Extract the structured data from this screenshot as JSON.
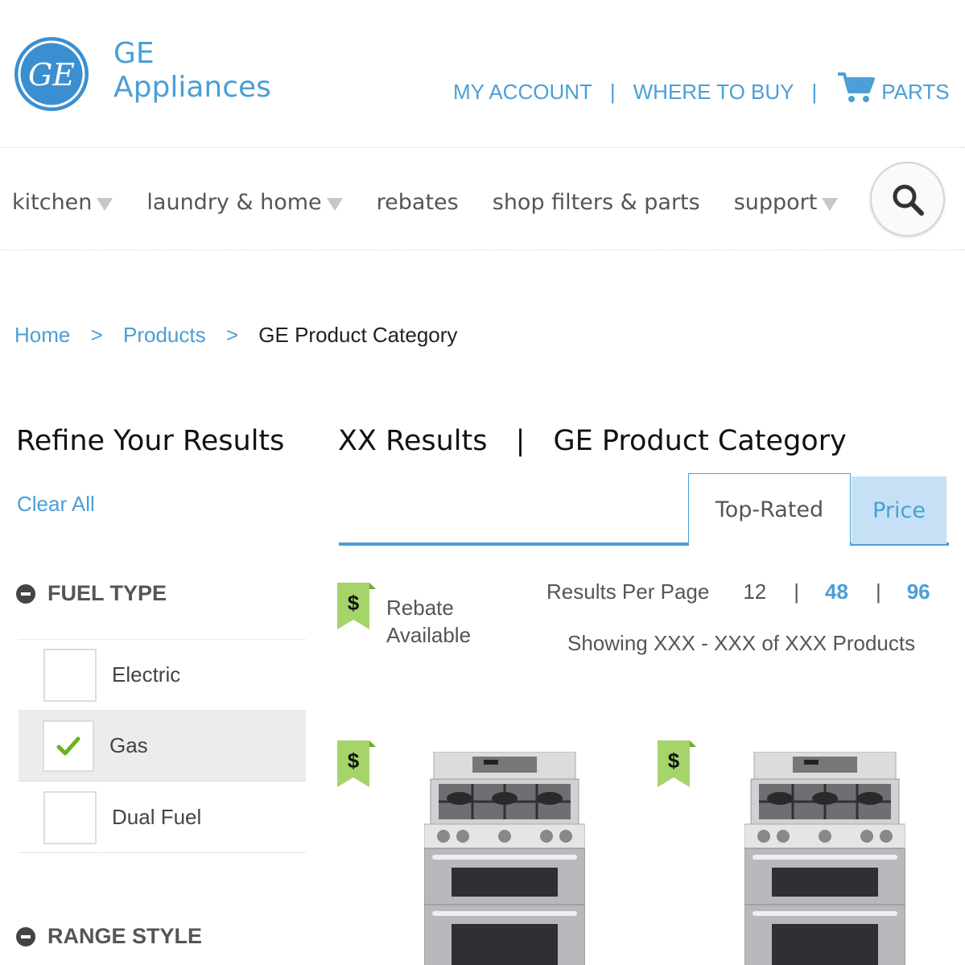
{
  "brand": {
    "line1": "GE",
    "line2": "Appliances",
    "logo_text": "GE"
  },
  "top_links": [
    {
      "label": "MY ACCOUNT"
    },
    {
      "label": "WHERE TO BUY"
    },
    {
      "label": "PARTS",
      "icon": "cart-icon"
    }
  ],
  "top_separator": "|",
  "nav": {
    "items": [
      {
        "label": "kitchen",
        "has_caret": true
      },
      {
        "label": "laundry & home",
        "has_caret": true
      },
      {
        "label": "rebates",
        "has_caret": false
      },
      {
        "label": "shop filters & parts",
        "has_caret": false
      },
      {
        "label": "support",
        "has_caret": true
      }
    ],
    "search_icon": "search-icon"
  },
  "breadcrumb": {
    "items": [
      "Home",
      "Products"
    ],
    "current": "GE Product Category",
    "separator": ">"
  },
  "sidebar": {
    "title": "Refine Your Results",
    "clear_all": "Clear All",
    "facets": [
      {
        "title": "FUEL TYPE",
        "options": [
          {
            "label": "Electric",
            "checked": false
          },
          {
            "label": "Gas",
            "checked": true
          },
          {
            "label": "Dual Fuel",
            "checked": false
          }
        ]
      },
      {
        "title": "RANGE STYLE",
        "options": []
      }
    ]
  },
  "results": {
    "count_label": "XX Results",
    "divider": "|",
    "category": "GE Product Category",
    "sort_tabs": [
      {
        "label": "Top-Rated",
        "active": true
      },
      {
        "label": "Price",
        "active": false
      }
    ],
    "rebate_legend": {
      "line1": "Rebate",
      "line2": "Available",
      "symbol": "$"
    },
    "per_page": {
      "label": "Results Per Page",
      "options": [
        "12",
        "48",
        "96"
      ],
      "current": "12",
      "separator": "|"
    },
    "showing": "Showing XXX - XXX of XXX Products"
  },
  "products": [
    {
      "image": "gas-range-double-oven",
      "rebate": true
    },
    {
      "image": "gas-range-double-oven",
      "rebate": true
    }
  ],
  "colors": {
    "accent": "#4a9fd6",
    "logo": "#3b8fd0",
    "tag_green": "#a5d46a",
    "check_green": "#6bb21d",
    "tab_selected_bg": "#c6e1f5"
  }
}
